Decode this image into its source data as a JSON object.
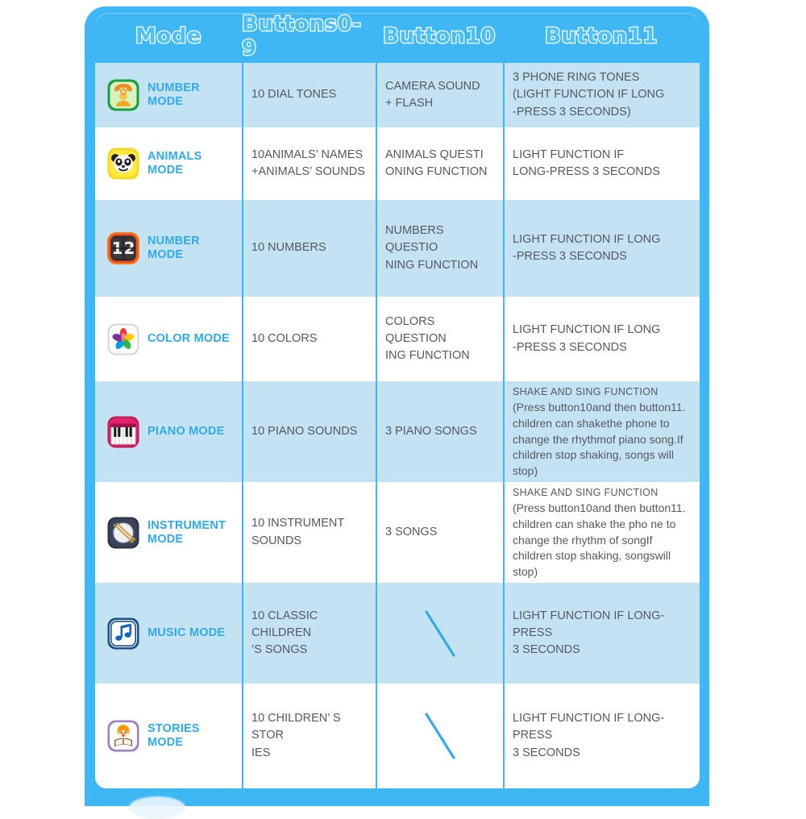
{
  "header": {
    "columns": [
      {
        "label": "Mode",
        "name": "col-mode"
      },
      {
        "label": "Buttons0-9",
        "name": "col-buttons-0-9"
      },
      {
        "label": "Button10",
        "name": "col-button-10"
      },
      {
        "label": "Button11",
        "name": "col-button-11"
      }
    ]
  },
  "colors": {
    "frame_blue": "#3fb7f5",
    "row_alt": "#c3e3f2",
    "row_plain": "#ffffff",
    "mode_label": "#31a9ef",
    "body_text": "#555a5e",
    "divider": "#3fb7f5"
  },
  "rows": [
    {
      "icon": "phone-icon",
      "mode": "NUMBER MODE",
      "buttons09": "10 DIAL TONES",
      "button10": "CAMERA SOUND\n+ FLASH",
      "button11": "3 PHONE RING TONES\n(LIGHT FUNCTION IF LONG\n-PRESS 3 SECONDS)",
      "button10_is_slash": false,
      "shaded": true
    },
    {
      "icon": "panda-icon",
      "mode": "ANIMALS MODE",
      "buttons09": "10ANIMALS’ NAMES\n+ANIMALS’ SOUNDS",
      "button10": "ANIMALS QUESTI\nONING FUNCTION",
      "button11": "LIGHT FUNCTION IF\nLONG-PRESS 3 SECONDS",
      "button10_is_slash": false,
      "shaded": false
    },
    {
      "icon": "flip-clock-12-icon",
      "mode": "NUMBER MODE",
      "buttons09": "10 NUMBERS",
      "button10": "NUMBERS QUESTIO\nNING FUNCTION",
      "button11": "LIGHT FUNCTION IF LONG\n-PRESS 3 SECONDS",
      "button10_is_slash": false,
      "shaded": true
    },
    {
      "icon": "color-pinwheel-icon",
      "mode": "COLOR MODE",
      "buttons09": "10 COLORS",
      "button10": "COLORS QUESTION\nING FUNCTION",
      "button11": "LIGHT FUNCTION IF LONG\n-PRESS 3 SECONDS",
      "button10_is_slash": false,
      "shaded": false
    },
    {
      "icon": "piano-icon",
      "mode": "PIANO MODE",
      "buttons09": "10 PIANO SOUNDS",
      "button10": "3 PIANO SONGS",
      "button11_prefix": "SHAKE AND SING FUNCTION ",
      "button11": "(Press button10and then button11. children can shakethe phone to change the rhythmof piano song.If children stop shaking, songs will stop)",
      "button10_is_slash": false,
      "shaded": true
    },
    {
      "icon": "drum-icon",
      "mode": "INSTRUMENT\nMODE",
      "buttons09": "10 INSTRUMENT\nSOUNDS",
      "button10": "3 SONGS",
      "button11_prefix": "SHAKE AND SING FUNCTION ",
      "button11": "(Press button10and then button11. children can shake the pho ne to change the rhythm of songIf children stop shaking, songswill stop)",
      "button10_is_slash": false,
      "shaded": false
    },
    {
      "icon": "music-note-icon",
      "mode": "MUSIC MODE",
      "buttons09": "10 CLASSIC CHILDREN\n’S SONGS",
      "button10": "",
      "button11": "LIGHT FUNCTION IF LONG-PRESS\n3 SECONDS",
      "button10_is_slash": true,
      "shaded": true
    },
    {
      "icon": "story-book-icon",
      "mode": "STORIES MODE",
      "buttons09": "10 CHILDREN’ S STOR\nIES",
      "button10": "",
      "button11": "LIGHT FUNCTION IF LONG-PRESS\n 3 SECONDS",
      "button10_is_slash": true,
      "shaded": false
    }
  ]
}
